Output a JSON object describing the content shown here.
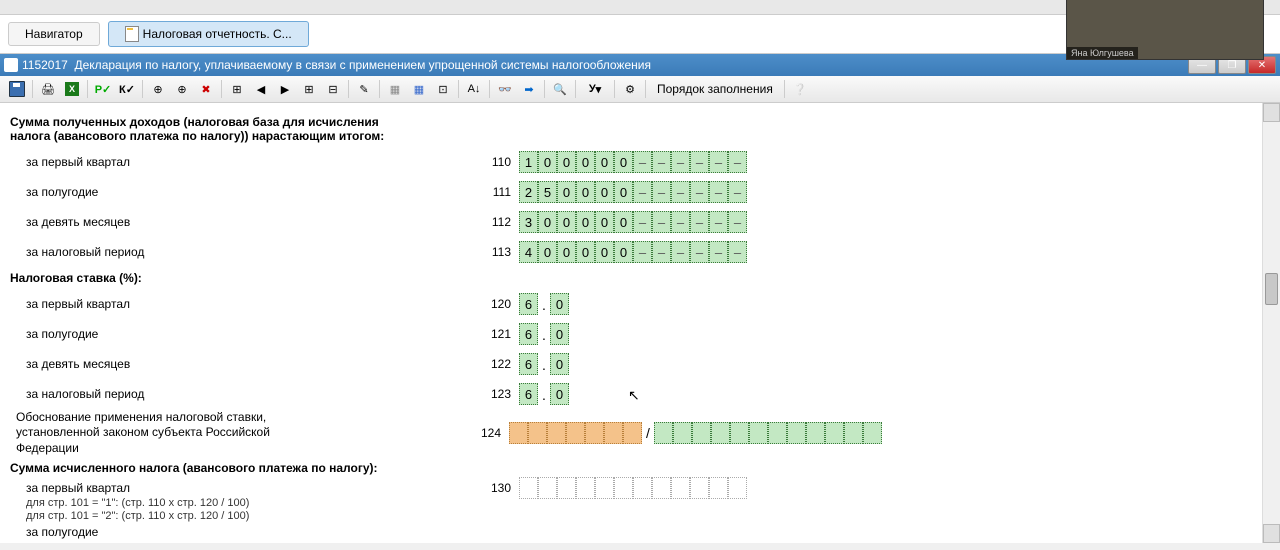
{
  "tabs": {
    "navigator": "Навигатор",
    "active": "Налоговая отчетность. С..."
  },
  "doc": {
    "code": "1152017",
    "title": "Декларация по налогу, уплачиваемому в связи с применением упрощенной системы налогообложения"
  },
  "toolbar": {
    "order": "Порядок заполнения",
    "y": "У"
  },
  "form": {
    "section1": {
      "header": "Сумма полученных доходов (налоговая база для исчисления налога (авансового платежа по налогу)) нарастающим итогом:",
      "rows": [
        {
          "label": "за первый квартал",
          "code": "110",
          "value": "100000"
        },
        {
          "label": "за полугодие",
          "code": "111",
          "value": "250000"
        },
        {
          "label": "за девять месяцев",
          "code": "112",
          "value": "300000"
        },
        {
          "label": "за налоговый период",
          "code": "113",
          "value": "400000"
        }
      ]
    },
    "section2": {
      "header": "Налоговая ставка (%):",
      "rows": [
        {
          "label": "за первый квартал",
          "code": "120",
          "int": "6",
          "dec": "0"
        },
        {
          "label": "за полугодие",
          "code": "121",
          "int": "6",
          "dec": "0"
        },
        {
          "label": "за девять месяцев",
          "code": "122",
          "int": "6",
          "dec": "0"
        },
        {
          "label": "за налоговый период",
          "code": "123",
          "int": "6",
          "dec": "0"
        }
      ]
    },
    "section_rate_basis": {
      "label": "Обоснование применения налоговой ставки, установленной законом субъекта Российской Федерации",
      "code": "124"
    },
    "section3": {
      "header": "Сумма исчисленного налога (авансового платежа по налогу):",
      "rows": [
        {
          "label": "за первый квартал",
          "code": "130",
          "sub1": "для стр. 101 = \"1\": (стр. 110 x стр. 120 / 100)",
          "sub2": "для стр. 101 = \"2\": (стр. 110 x стр. 120 / 100)"
        },
        {
          "label": "за полугодие"
        }
      ]
    }
  },
  "webcam_label": "Яна Юлгушева"
}
